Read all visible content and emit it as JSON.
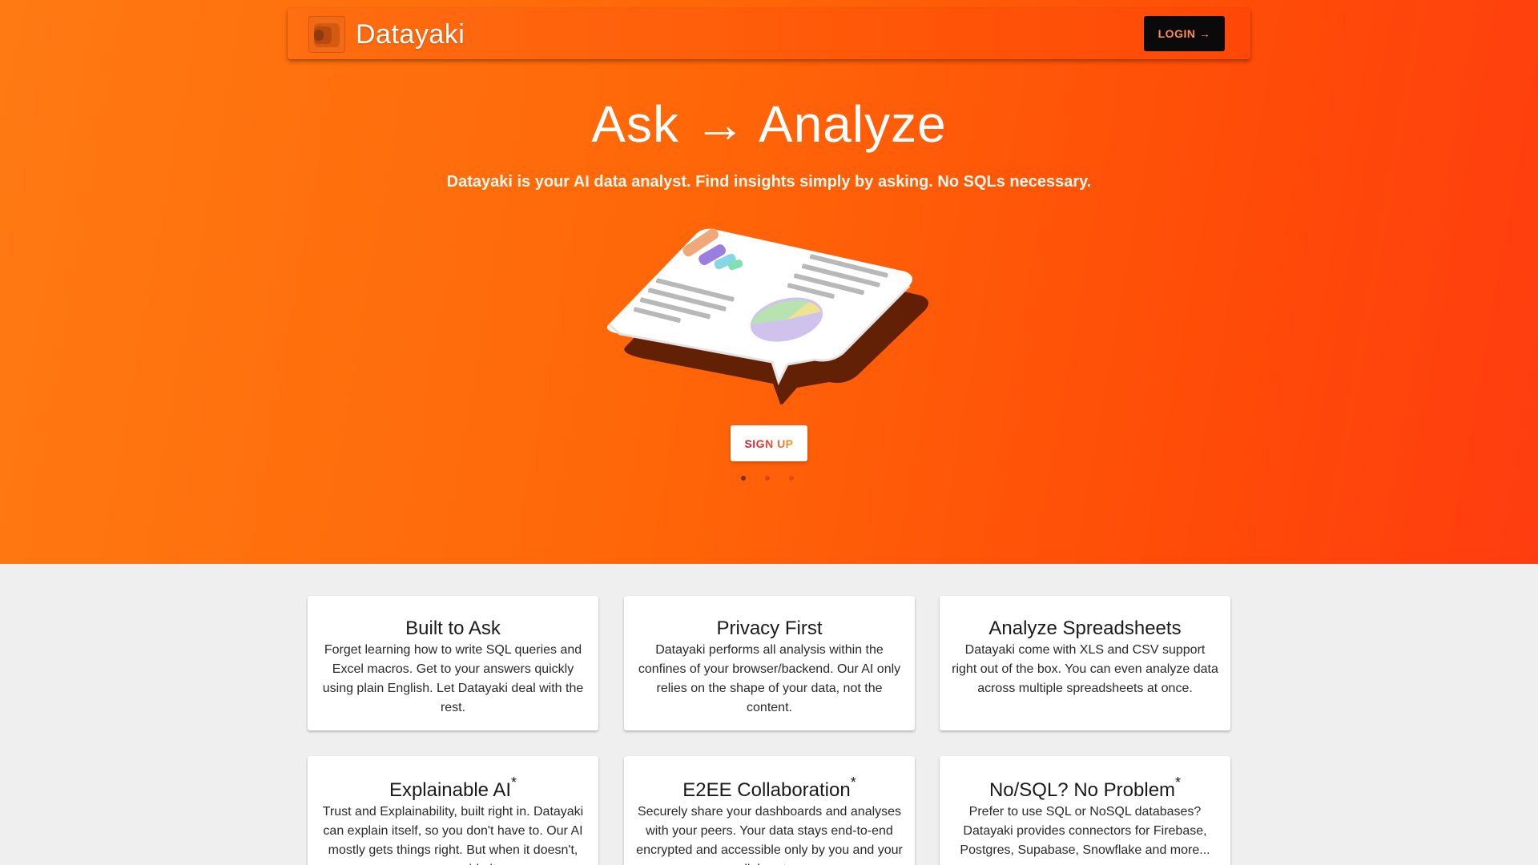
{
  "nav": {
    "brand": "Datayaki",
    "login_label": "LOGIN →"
  },
  "hero": {
    "title": "Ask → Analyze",
    "subtitle": "Datayaki is your AI data analyst. Find insights simply by asking. No SQLs necessary.",
    "signup_label": "SIGN UP",
    "carousel": {
      "slides": 3,
      "active_index": 0
    }
  },
  "features": [
    {
      "title": "Built to Ask",
      "asterisk": "",
      "body": "Forget learning how to write SQL queries and Excel macros. Get to your answers quickly using plain English. Let Datayaki deal with the rest."
    },
    {
      "title": "Privacy First",
      "asterisk": "",
      "body": "Datayaki performs all analysis within the confines of your browser/backend. Our AI only relies on the shape of your data, not the content."
    },
    {
      "title": "Analyze Spreadsheets",
      "asterisk": "",
      "body": "Datayaki come with XLS and CSV support right out of the box. You can even analyze data across multiple spreadsheets at once."
    },
    {
      "title": "Explainable AI",
      "asterisk": "*",
      "body": "Trust and Explainability, built right in. Datayaki can explain itself, so you don't have to. Our AI mostly gets things right. But when it doesn't, you can guide it."
    },
    {
      "title": "E2EE Collaboration",
      "asterisk": "*",
      "body": "Securely share your dashboards and analyses with your peers. Your data stays end-to-end encrypted and accessible only by you and your collaborators."
    },
    {
      "title": "No/SQL? No Problem",
      "asterisk": "*",
      "body": "Prefer to use SQL or NoSQL databases? Datayaki provides connectors for Firebase, Postgres, Supabase, Snowflake and more..."
    }
  ],
  "colors": {
    "hero_gradient_start": "#ff7a12",
    "hero_gradient_end": "#ff3d10",
    "login_bg": "#0a0a0a",
    "login_text": "#ff8c4a",
    "page_bg": "#efefef"
  },
  "icons": {
    "logo": "datayaki-logo-icon",
    "illustration": "dashboard-chat-bubble-illustration"
  }
}
